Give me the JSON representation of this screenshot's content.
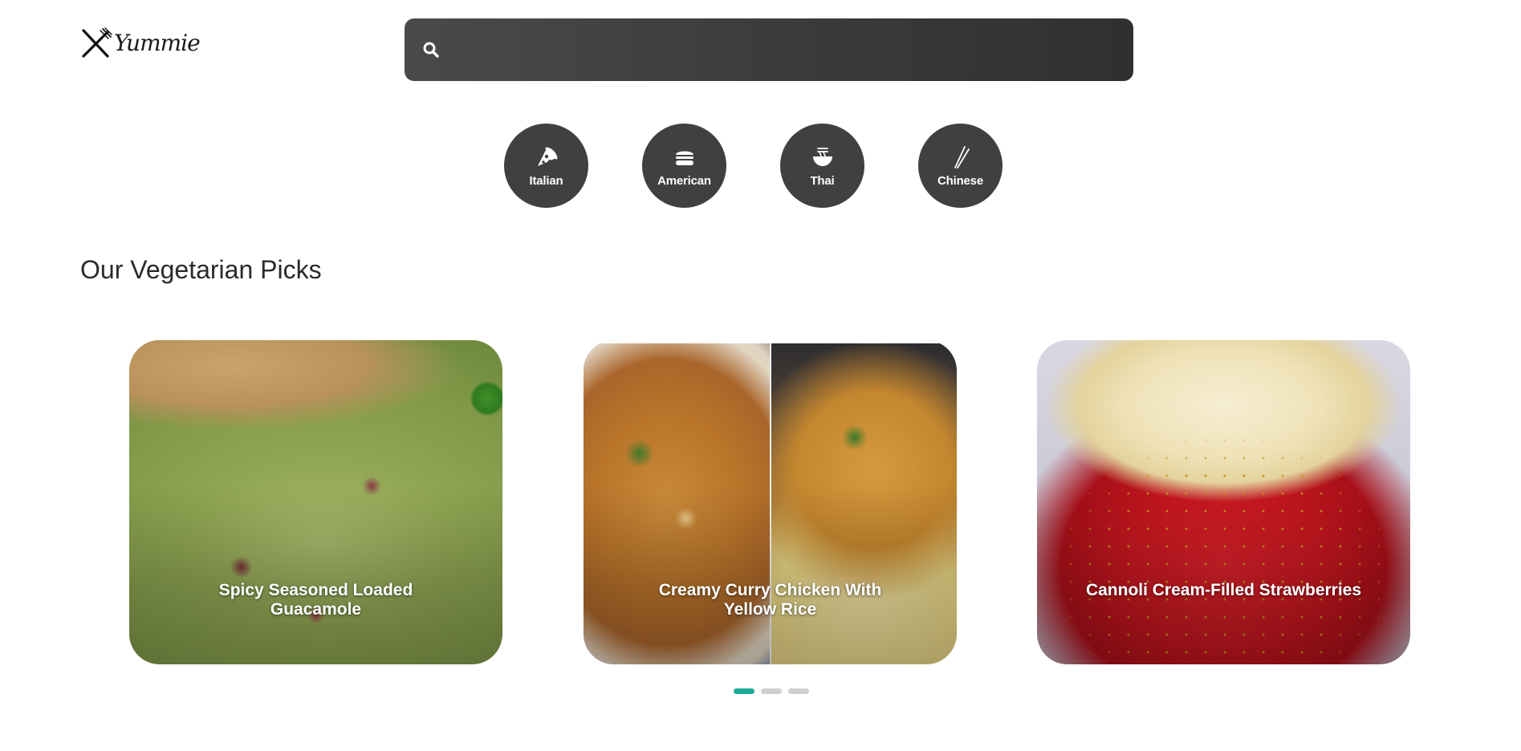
{
  "brand": {
    "name": "Yummie",
    "logo_icon": "fork-knife-icon"
  },
  "search": {
    "placeholder": "",
    "value": "",
    "icon": "search-icon"
  },
  "cuisines": [
    {
      "label": "Italian",
      "icon": "pizza-icon"
    },
    {
      "label": "American",
      "icon": "burger-icon"
    },
    {
      "label": "Thai",
      "icon": "noodle-bowl-icon"
    },
    {
      "label": "Chinese",
      "icon": "chopsticks-icon"
    }
  ],
  "section": {
    "title": "Our Vegetarian Picks"
  },
  "carousel": {
    "cards": [
      {
        "title": "Spicy Seasoned Loaded Guacamole"
      },
      {
        "title": "Creamy Curry Chicken With Yellow Rice"
      },
      {
        "title": "Cannoli Cream-Filled Strawberries"
      }
    ],
    "page_count": 3,
    "active_page": 1
  },
  "colors": {
    "search_background": "#3c3c3c",
    "cuisine_button": "#404040",
    "dot_active": "#1ba99a",
    "dot_inactive": "#cfcfcf"
  }
}
